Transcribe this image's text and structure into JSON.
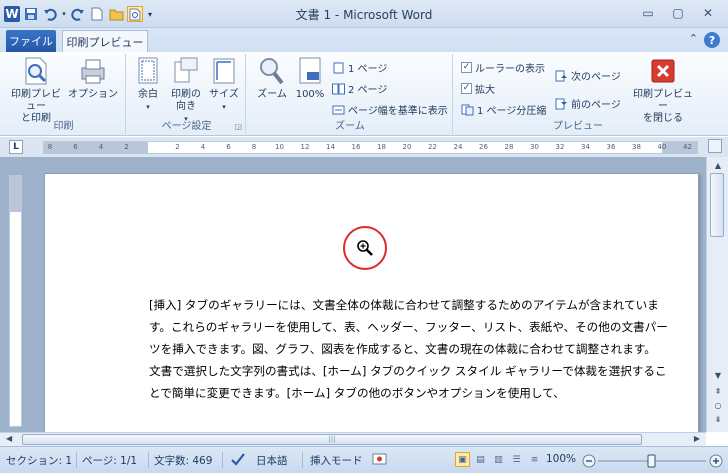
{
  "window": {
    "title": "文書 1 - Microsoft Word"
  },
  "tabs": {
    "file": "ファイル",
    "print_preview": "印刷プレビュー"
  },
  "ribbon": {
    "groups": {
      "print": {
        "label": "印刷",
        "print_preview_and_print": "印刷プレビュー\nと印刷",
        "options": "オプション"
      },
      "page_setup": {
        "label": "ページ設定",
        "margins": "余白",
        "orientation": "印刷の\n向き",
        "size": "サイズ"
      },
      "zoom": {
        "label": "ズーム",
        "zoom": "ズーム",
        "hundred": "100%",
        "one_page": "1 ページ",
        "two_pages": "2 ページ",
        "page_width": "ページ幅を基準に表示"
      },
      "preview": {
        "label": "プレビュー",
        "show_ruler": "ルーラーの表示",
        "show_ruler_checked": true,
        "magnifier": "拡大",
        "magnifier_checked": true,
        "shrink_one_page": "1 ページ分圧縮",
        "next_page": "次のページ",
        "prev_page": "前のページ",
        "close_preview": "印刷プレビュー\nを閉じる"
      }
    }
  },
  "ruler": {
    "corner": "L",
    "ticks": [
      "8",
      "6",
      "4",
      "2",
      "",
      "2",
      "4",
      "6",
      "8",
      "10",
      "12",
      "14",
      "16",
      "18",
      "20",
      "22",
      "24",
      "26",
      "28",
      "30",
      "32",
      "34",
      "36",
      "38",
      "40",
      "42"
    ]
  },
  "document": {
    "paragraphs": [
      "[挿入] タブのギャラリーには、文書全体の体裁に合わせて調整するためのアイテムが含まれています。これらのギャラリーを使用して、表、ヘッダー、フッター、リスト、表紙や、その他の文書パーツを挿入できます。図、グラフ、図表を作成すると、文書の現在の体裁に合わせて調整されます。",
      "文書で選択した文字列の書式は、[ホーム] タブのクイック スタイル ギャラリーで体裁を選択することで簡単に変更できます。[ホーム] タブの他のボタンやオプションを使用して、"
    ]
  },
  "statusbar": {
    "section": "セクション: 1",
    "page": "ページ: 1/1",
    "words": "文字数: 469",
    "language": "日本語",
    "mode": "挿入モード",
    "zoom": "100%"
  },
  "colors": {
    "accent": "#2557a7",
    "highlight_circle": "#e02a2a"
  }
}
